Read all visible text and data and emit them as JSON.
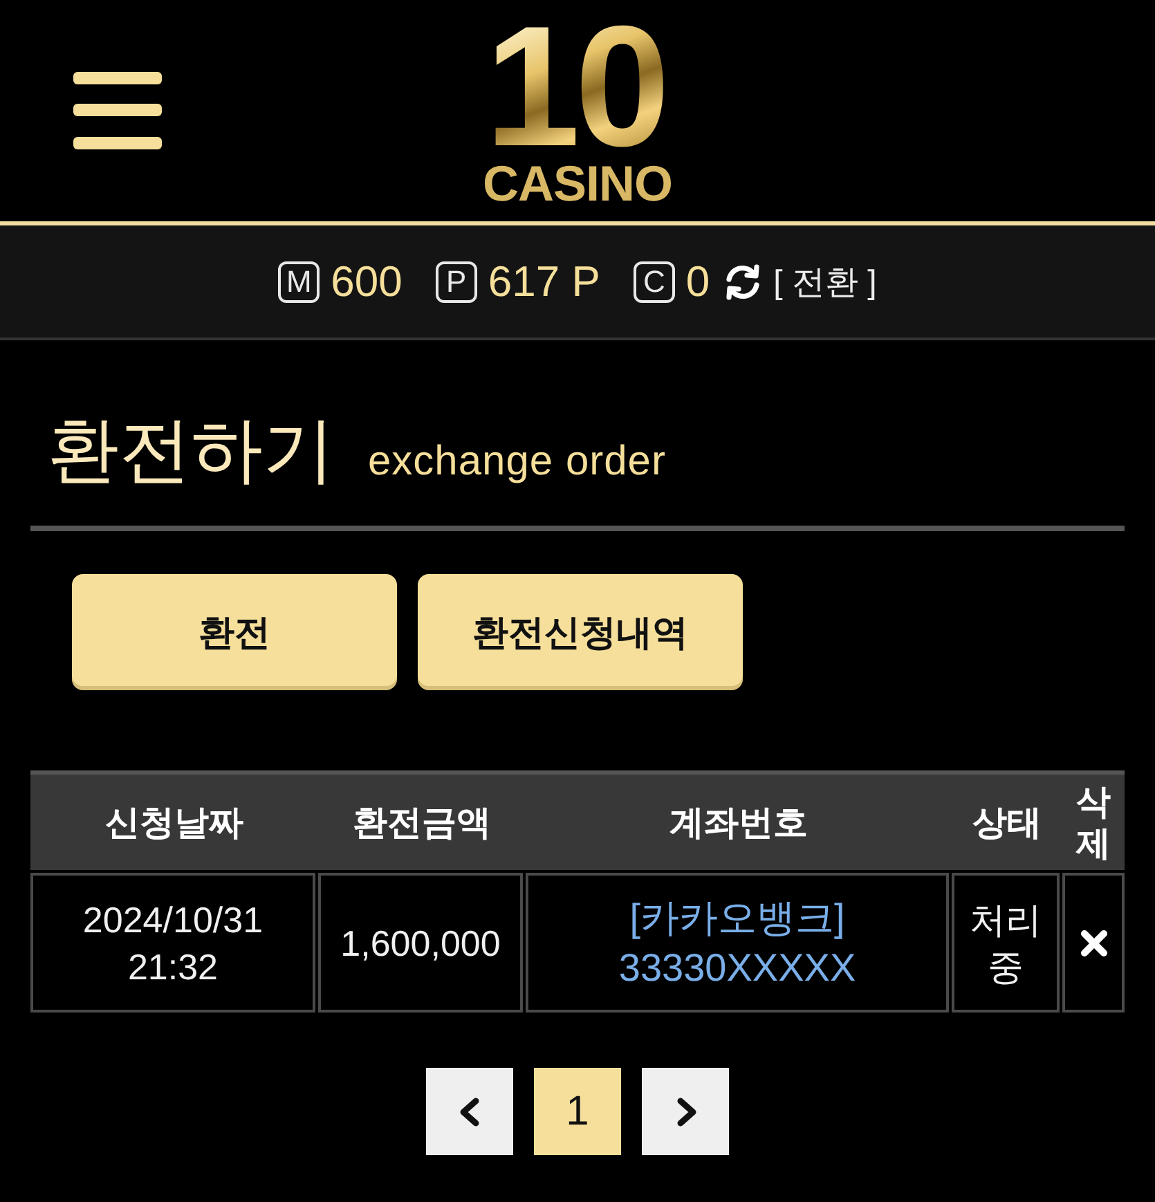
{
  "header": {
    "logo_number": "10",
    "logo_wordmark": "CASINO"
  },
  "balances": {
    "items": [
      {
        "mark": "M",
        "value": "600"
      },
      {
        "mark": "P",
        "value": "617 P"
      },
      {
        "mark": "C",
        "value": "0"
      }
    ],
    "convert_link": "[ 전환 ]"
  },
  "page_title": {
    "title": "환전하기",
    "subtitle": "exchange order"
  },
  "actions": [
    "환전",
    "환전신청내역"
  ],
  "table": {
    "columns": [
      "신청날짜",
      "환전금액",
      "계좌번호",
      "상태",
      "삭제"
    ],
    "rows": [
      {
        "requested_at": "2024/10/31 21:32",
        "amount": "1,600,000",
        "account": "[카카오뱅크] 33330XXXXX",
        "status": "처리중"
      }
    ]
  },
  "pagination": {
    "pages": [
      {
        "label": "1",
        "selected": true
      }
    ]
  }
}
